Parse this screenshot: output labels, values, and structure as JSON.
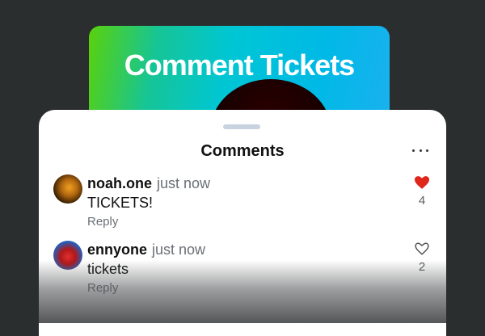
{
  "promo": {
    "title": "Comment Tickets"
  },
  "sheet": {
    "title": "Comments",
    "more_icon": "more-horizontal-icon"
  },
  "comments": [
    {
      "username": "noah.one",
      "time": "just now",
      "text": "TICKETS!",
      "reply_label": "Reply",
      "likes": "4",
      "liked": true,
      "like_color": "#e0261b"
    },
    {
      "username": "ennyone",
      "time": "just now",
      "text": "tickets",
      "reply_label": "Reply",
      "likes": "2",
      "liked": false,
      "like_color": "#555555"
    }
  ],
  "colors": {
    "background": "#2b2e2f",
    "accent": "#e0261b",
    "handle": "#c9d2df"
  }
}
